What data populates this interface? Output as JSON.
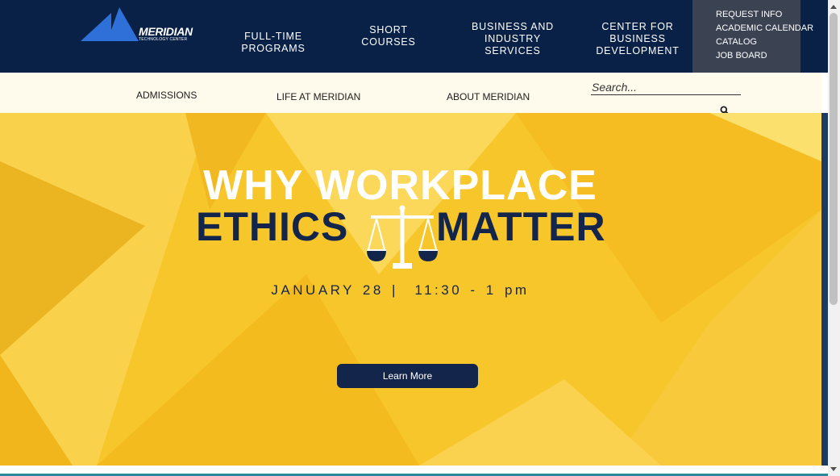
{
  "header": {
    "logo_text": "MERIDIAN",
    "logo_subtext": "TECHNOLOGY CENTER",
    "nav": [
      {
        "label": "FULL-TIME PROGRAMS"
      },
      {
        "label": "SHORT COURSES"
      },
      {
        "label": "BUSINESS AND INDUSTRY SERVICES"
      },
      {
        "label": "CENTER FOR BUSINESS DEVELOPMENT"
      }
    ],
    "quick_links": [
      {
        "label": "REQUEST INFO"
      },
      {
        "label": "ACADEMIC CALENDAR"
      },
      {
        "label": "CATALOG"
      },
      {
        "label": "JOB BOARD"
      }
    ]
  },
  "subnav": {
    "items": [
      {
        "label": "ADMISSIONS"
      },
      {
        "label": "LIFE AT MERIDIAN"
      },
      {
        "label": "ABOUT MERIDIAN"
      }
    ],
    "search_placeholder": "Search...",
    "search_icon": "magnifier-icon"
  },
  "hero": {
    "line1": "WHY WORKPLACE",
    "line2_left": "ETHICS",
    "line2_right": "MATTER",
    "date": "JANUARY 28 |  11:30 - 1 pm",
    "button_label": "Learn More",
    "icon": "scales-of-justice-icon"
  },
  "colors": {
    "navy": "#0a2147",
    "hero_yellow": "#f7c62a",
    "dark_text": "#13254a",
    "logo_blue": "#2f6fd8",
    "quick_links_bg": "#3b4252",
    "subnav_bg": "#fffbec"
  }
}
